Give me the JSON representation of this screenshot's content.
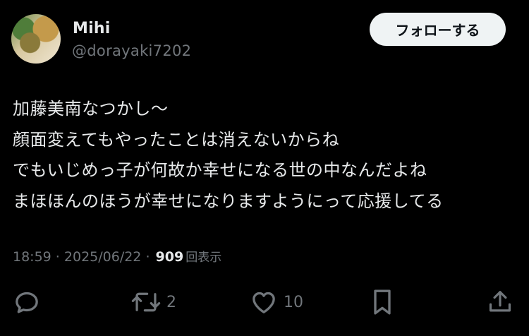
{
  "user": {
    "display_name": "Mihi",
    "handle": "@dorayaki7202",
    "avatar_icon": "food-photo-avatar"
  },
  "follow_button": {
    "label": "フォローする"
  },
  "tweet": {
    "lines": [
      "加藤美南なつかし〜",
      "顔面変えてもやったことは消えないからね",
      "でもいじめっ子が何故か幸せになる世の中なんだよね",
      "まほほんのほうが幸せになりますようにって応援してる"
    ]
  },
  "meta": {
    "time": "18:59",
    "sep1": " · ",
    "date": "2025/06/22",
    "sep2": " · ",
    "views": "909",
    "views_label": "回表示"
  },
  "actions": {
    "reply": {
      "icon": "reply-icon"
    },
    "retweet": {
      "icon": "retweet-icon",
      "count": "2"
    },
    "like": {
      "icon": "heart-icon",
      "count": "10"
    },
    "bookmark": {
      "icon": "bookmark-icon"
    },
    "share": {
      "icon": "share-icon"
    }
  },
  "colors": {
    "background": "#000000",
    "primary_text": "#e7e9ea",
    "secondary_text": "#71767b",
    "follow_bg": "#eff3f4"
  }
}
